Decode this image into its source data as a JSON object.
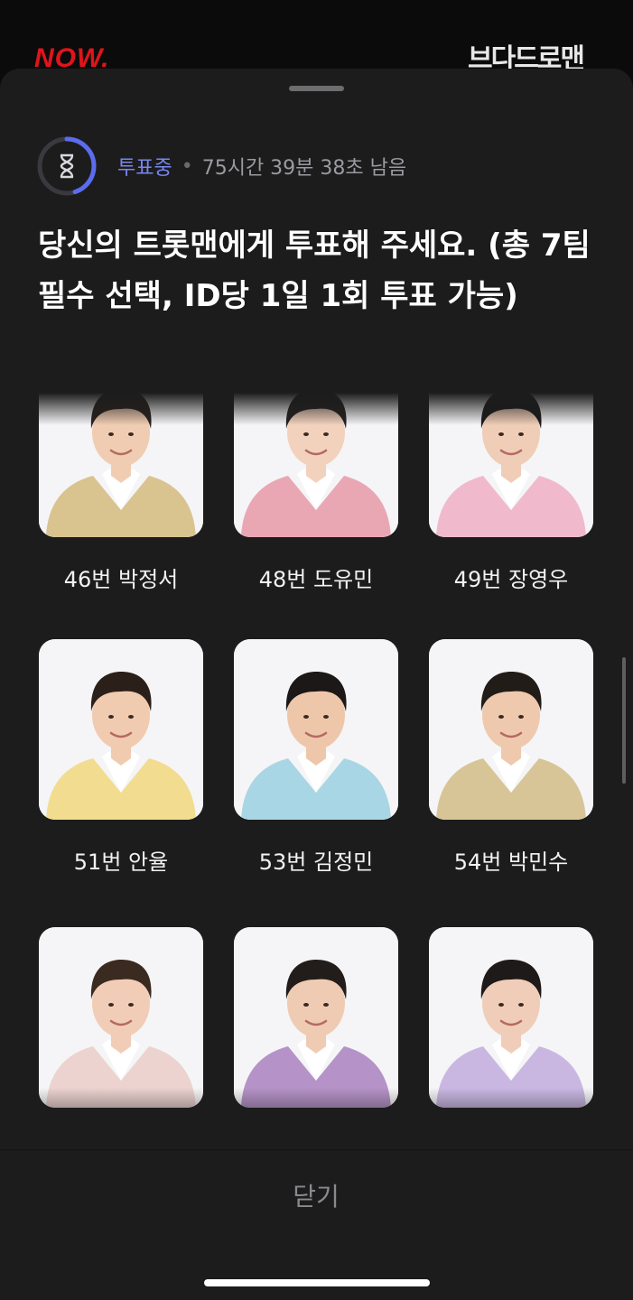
{
  "backdrop": {
    "brand_left": "NOW.",
    "brand_right": "브다드로맨"
  },
  "vote": {
    "status_label": "투표중",
    "separator": "•",
    "time_remaining": "75시간 39분 38초 남음",
    "timer_progress": 0.45,
    "title": "당신의 트롯맨에게 투표해 주세요. (총 7팀 필수 선택, ID당 1일 1회 투표 가능)"
  },
  "candidates": [
    {
      "name": "46번 박정서",
      "suit": "#d9c38f",
      "shirt": "#ffffff",
      "hair": "#2a211b",
      "skin": "#f0cdb2"
    },
    {
      "name": "48번 도유민",
      "suit": "#e9a7b4",
      "shirt": "#ffffff",
      "hair": "#24201e",
      "skin": "#f2d2bd"
    },
    {
      "name": "49번 장영우",
      "suit": "#f1b9cc",
      "shirt": "#ffffff",
      "hair": "#1d1a19",
      "skin": "#efcdb6"
    },
    {
      "name": "51번 안율",
      "suit": "#f2dc8f",
      "shirt": "#ffffff",
      "hair": "#2b1f19",
      "skin": "#f0cbb0"
    },
    {
      "name": "53번 김정민",
      "suit": "#a9d6e4",
      "shirt": "#ffffff",
      "hair": "#1b1817",
      "skin": "#eec7ab"
    },
    {
      "name": "54번 박민수",
      "suit": "#d8c597",
      "shirt": "#ffffff",
      "hair": "#221c18",
      "skin": "#efc9ae"
    },
    {
      "name": "",
      "suit": "#ecd3cf",
      "shirt": "#ffffff",
      "hair": "#3a2a20",
      "skin": "#f1cdb7"
    },
    {
      "name": "",
      "suit": "#b592c7",
      "shirt": "#ffffff",
      "hair": "#221d1b",
      "skin": "#efcbb3"
    },
    {
      "name": "",
      "suit": "#c9b7e2",
      "shirt": "#ffffff",
      "hair": "#1e1a19",
      "skin": "#f0cdb8"
    }
  ],
  "footer": {
    "close_label": "닫기"
  },
  "colors": {
    "accent": "#7a86f0",
    "sheet_background": "#1c1c1d"
  }
}
